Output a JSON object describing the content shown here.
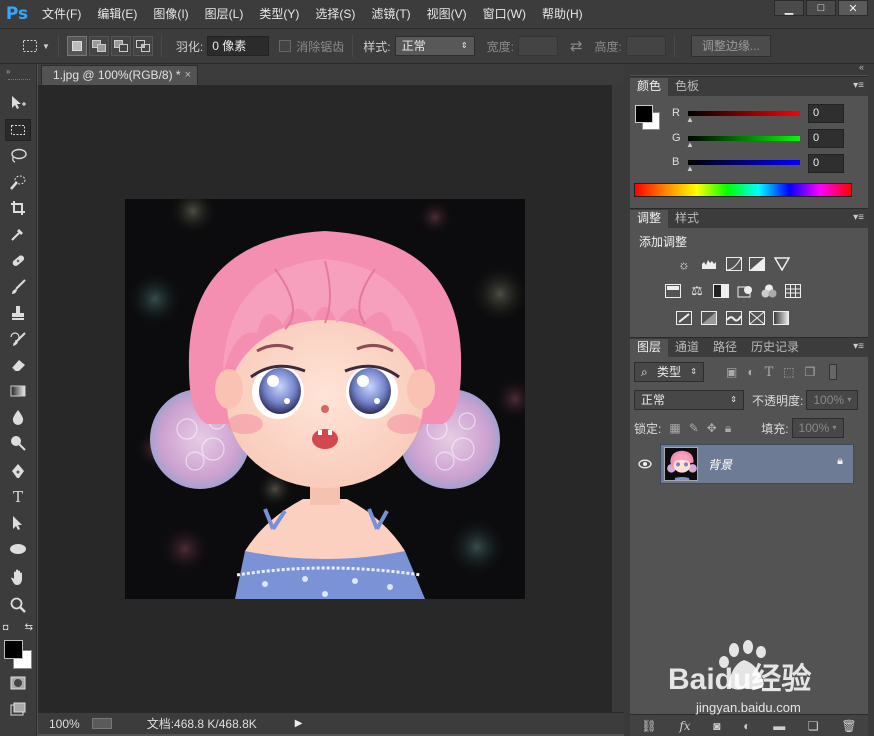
{
  "app": {
    "logo": "Ps"
  },
  "menu": [
    "文件(F)",
    "编辑(E)",
    "图像(I)",
    "图层(L)",
    "类型(Y)",
    "选择(S)",
    "滤镜(T)",
    "视图(V)",
    "窗口(W)",
    "帮助(H)"
  ],
  "window_controls": {
    "minimize": "▁",
    "maximize": "□",
    "close": "✕"
  },
  "options": {
    "feather_label": "羽化:",
    "feather_value": "0 像素",
    "antialias_label": "消除锯齿",
    "style_label": "样式:",
    "style_value": "正常",
    "width_label": "宽度:",
    "height_label": "高度:",
    "refine_edge_label": "调整边缘..."
  },
  "document": {
    "tab_title": "1.jpg @ 100%(RGB/8) *",
    "close": "×"
  },
  "status": {
    "zoom": "100%",
    "doc_info": "文档:468.8 K/468.8K"
  },
  "color_panel": {
    "tabs": [
      "颜色",
      "色板"
    ],
    "channels": [
      {
        "label": "R",
        "value": "0",
        "color": "#ff0000"
      },
      {
        "label": "G",
        "value": "0",
        "color": "#00ff00"
      },
      {
        "label": "B",
        "value": "0",
        "color": "#0000ff"
      }
    ],
    "foreground": "#000000",
    "background": "#ffffff"
  },
  "adjustments_panel": {
    "tabs": [
      "调整",
      "样式"
    ],
    "title": "添加调整"
  },
  "layers_panel": {
    "tabs": [
      "图层",
      "通道",
      "路径",
      "历史记录"
    ],
    "filter_label": "类型",
    "blend_mode": "正常",
    "opacity_label": "不透明度:",
    "opacity_value": "100%",
    "lock_label": "锁定:",
    "fill_label": "填充:",
    "fill_value": "100%",
    "layers": [
      {
        "name": "背景",
        "visible": true,
        "locked": true
      }
    ]
  },
  "watermark": {
    "brand_text": "Baidu经验",
    "url": "jingyan.baidu.com"
  }
}
